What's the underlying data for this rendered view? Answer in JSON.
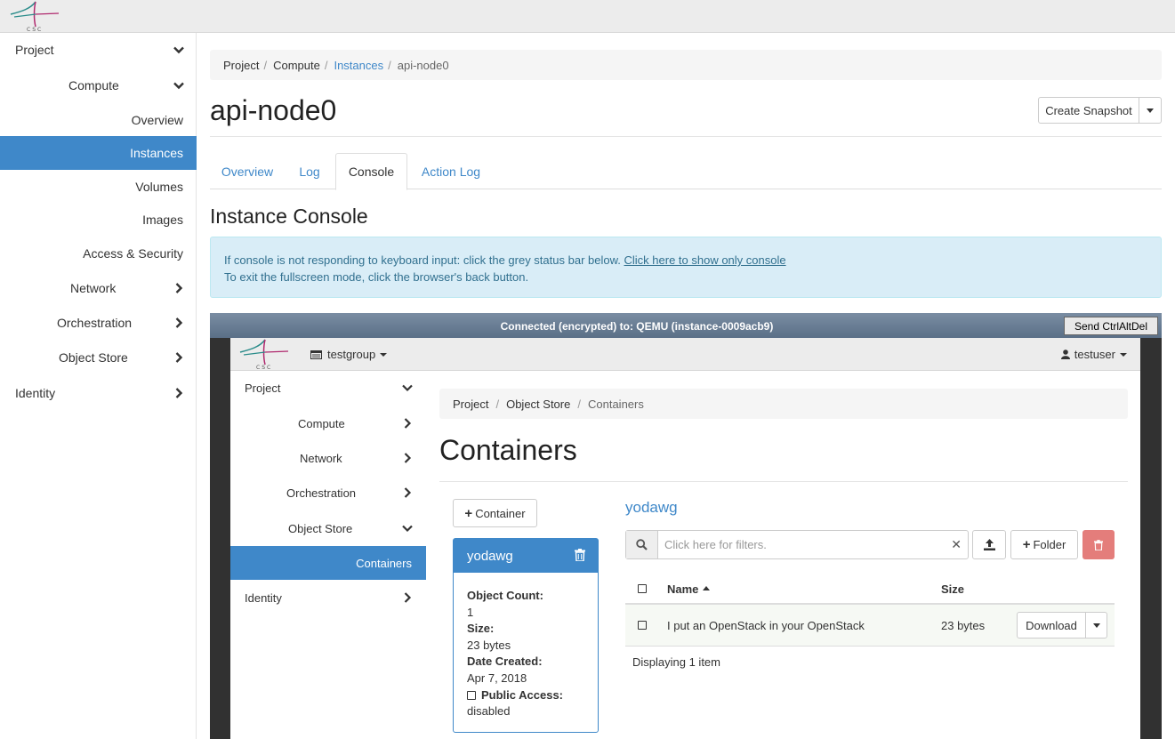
{
  "logo_text": "CSC",
  "sidebar": {
    "items": [
      {
        "label": "Project"
      },
      {
        "label": "Compute"
      },
      {
        "label": "Overview"
      },
      {
        "label": "Instances"
      },
      {
        "label": "Volumes"
      },
      {
        "label": "Images"
      },
      {
        "label": "Access & Security"
      },
      {
        "label": "Network"
      },
      {
        "label": "Orchestration"
      },
      {
        "label": "Object Store"
      },
      {
        "label": "Identity"
      }
    ]
  },
  "breadcrumb": {
    "items": [
      "Project",
      "Compute",
      "Instances",
      "api-node0"
    ]
  },
  "page_title": "api-node0",
  "actions": {
    "snapshot_label": "Create Snapshot"
  },
  "tabs": [
    "Overview",
    "Log",
    "Console",
    "Action Log"
  ],
  "section_title": "Instance Console",
  "info": {
    "line1": "If console is not responding to keyboard input: click the grey status bar below.",
    "link": "Click here to show only console",
    "line2": "To exit the fullscreen mode, click the browser's back button."
  },
  "console": {
    "status": "Connected (encrypted) to: QEMU (instance-0009acb9)",
    "ctrl_alt_del": "Send CtrlAltDel"
  },
  "inner": {
    "project_group": "testgroup",
    "user": "testuser",
    "sidebar": [
      "Project",
      "Compute",
      "Network",
      "Orchestration",
      "Object Store",
      "Containers",
      "Identity"
    ],
    "breadcrumb": [
      "Project",
      "Object Store",
      "Containers"
    ],
    "title": "Containers",
    "add_container": "Container",
    "container": {
      "name": "yodawg",
      "object_count_label": "Object Count:",
      "object_count": "1",
      "size_label": "Size:",
      "size": "23 bytes",
      "date_label": "Date Created:",
      "date": "Apr 7, 2018",
      "public_label": "Public Access:",
      "public": "disabled"
    },
    "selected_container": "yodawg",
    "filter_placeholder": "Click here for filters.",
    "folder_btn": "Folder",
    "table": {
      "headers": {
        "name": "Name",
        "size": "Size"
      },
      "rows": [
        {
          "name": "I put an OpenStack in your OpenStack",
          "size": "23 bytes",
          "action": "Download"
        }
      ],
      "footer": "Displaying 1 item"
    }
  },
  "colors": {
    "primary": "#3f88c9",
    "info_bg": "#d9edf7",
    "danger": "#e47d7b"
  }
}
